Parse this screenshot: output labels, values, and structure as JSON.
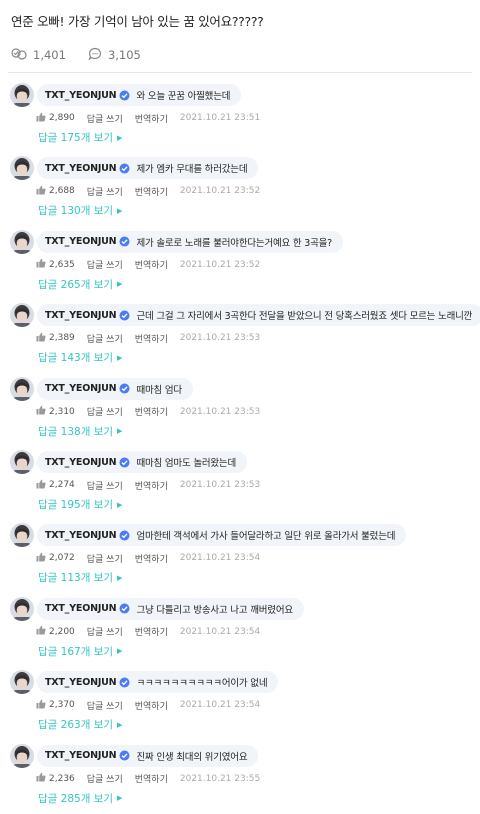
{
  "post": {
    "title": "연준 오빠! 가장 기억이 남아 있는 꿈 있어요?????",
    "likes_count": "1,401",
    "comments_count": "3,105"
  },
  "labels": {
    "reply": "답글 쓰기",
    "translate": "번역하기"
  },
  "colors": {
    "accent": "#35c5c0",
    "verified": "#4a7cf7",
    "bubble": "#f1f4f8"
  },
  "comments": [
    {
      "author": "TXT_YEONJUN",
      "text": "와 오늘 꾼꿈 아찔했는데",
      "likes": "2,890",
      "time": "2021.10.21 23:51",
      "replies": "답글 175개 보기"
    },
    {
      "author": "TXT_YEONJUN",
      "text": "제가 엠카 무대를 하러갔는데",
      "likes": "2,688",
      "time": "2021.10.21 23:52",
      "replies": "답글 130개 보기"
    },
    {
      "author": "TXT_YEONJUN",
      "text": "제가 솔로로 노래를 불러야한다는거예요 한 3곡을?",
      "likes": "2,635",
      "time": "2021.10.21 23:52",
      "replies": "답글 265개 보기"
    },
    {
      "author": "TXT_YEONJUN",
      "text": "근데 그걸 그 자리에서 3곡한다 전달을 받았으니 전 당혹스러웠죠 셋다 모르는 노래니깐",
      "likes": "2,389",
      "time": "2021.10.21 23:53",
      "replies": "답글 143개 보기"
    },
    {
      "author": "TXT_YEONJUN",
      "text": "때마침 엄다",
      "likes": "2,310",
      "time": "2021.10.21 23:53",
      "replies": "답글 138개 보기"
    },
    {
      "author": "TXT_YEONJUN",
      "text": "때마침 엄마도 놀러왔는데",
      "likes": "2,274",
      "time": "2021.10.21 23:53",
      "replies": "답글 195개 보기"
    },
    {
      "author": "TXT_YEONJUN",
      "text": "엄마한테 객석에서 가사 들어달라하고 일단 위로 올라가서 불렀는데",
      "likes": "2,072",
      "time": "2021.10.21 23:54",
      "replies": "답글 113개 보기"
    },
    {
      "author": "TXT_YEONJUN",
      "text": "그냥 다틀리고 방송사고 나고 깨버렸어요",
      "likes": "2,200",
      "time": "2021.10.21 23:54",
      "replies": "답글 167개 보기"
    },
    {
      "author": "TXT_YEONJUN",
      "text": "ㅋㅋㅋㅋㅋㅋㅋㅋㅋㅋ어이가 없네",
      "likes": "2,370",
      "time": "2021.10.21 23:54",
      "replies": "답글 263개 보기"
    },
    {
      "author": "TXT_YEONJUN",
      "text": "진짜 인생 최대의 위기였어요",
      "likes": "2,236",
      "time": "2021.10.21 23:55",
      "replies": "답글 285개 보기"
    }
  ]
}
